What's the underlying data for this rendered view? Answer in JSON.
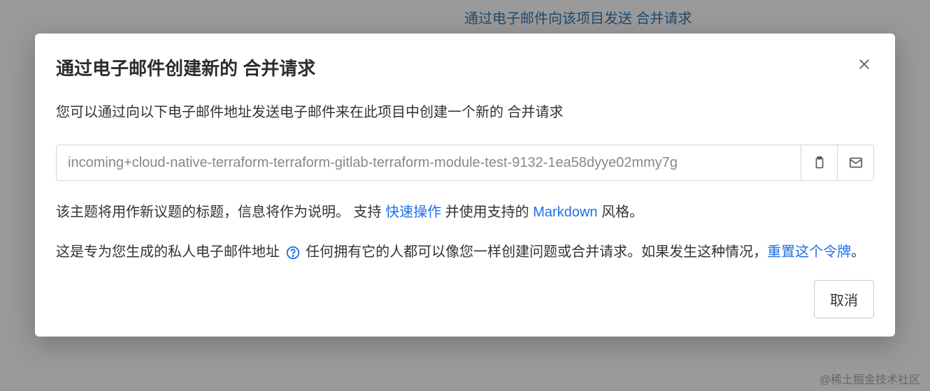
{
  "backdrop": {
    "link_text": "通过电子邮件向该项目发送 合并请求"
  },
  "modal": {
    "title": "通过电子邮件创建新的 合并请求",
    "description": "您可以通过向以下电子邮件地址发送电子邮件来在此项目中创建一个新的 合并请求",
    "email_value": "incoming+cloud-native-terraform-terraform-gitlab-terraform-module-test-9132-1ea58dyye02mmy7g",
    "help1_pre": "该主题将用作新议题的标题，信息将作为说明。 支持 ",
    "quick_actions": "快速操作",
    "help1_mid": " 并使用支持的 ",
    "markdown": "Markdown",
    "help1_post": " 风格。",
    "help2_pre": "这是专为您生成的私人电子邮件地址 ",
    "help2_mid": " 任何拥有它的人都可以像您一样创建问题或合并请求。如果发生这种情况，",
    "reset_link": "重置这个令牌",
    "help2_post": "。",
    "cancel": "取消"
  },
  "watermark": "@稀土掘金技术社区"
}
